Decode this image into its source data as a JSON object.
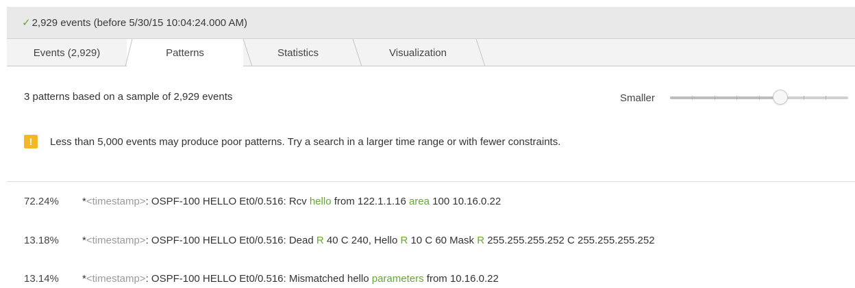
{
  "status": {
    "check_icon": "check-icon",
    "text": "2,929 events (before 5/30/15 10:04:24.000 AM)"
  },
  "tabs": [
    {
      "label": "Events (2,929)",
      "active": false
    },
    {
      "label": "Patterns",
      "active": true
    },
    {
      "label": "Statistics",
      "active": false
    },
    {
      "label": "Visualization",
      "active": false
    }
  ],
  "summary": "3 patterns based on a sample of 2,929 events",
  "slider": {
    "label": "Smaller",
    "value_fraction": 0.62
  },
  "warning": {
    "icon_glyph": "!",
    "text": "Less than 5,000 events may produce poor patterns. Try a search in a larger time range or with fewer constraints."
  },
  "patterns": [
    {
      "pct": "72.24%",
      "segments": [
        {
          "text": "*",
          "style": "plain"
        },
        {
          "text": "<timestamp>",
          "style": "ts"
        },
        {
          "text": ": OSPF-100 HELLO Et0/0.516: Rcv ",
          "style": "plain"
        },
        {
          "text": "hello",
          "style": "hl"
        },
        {
          "text": " from 122.1.1.16 ",
          "style": "plain"
        },
        {
          "text": "area",
          "style": "hl"
        },
        {
          "text": " 100 10.16.0.22",
          "style": "plain"
        }
      ]
    },
    {
      "pct": "13.18%",
      "segments": [
        {
          "text": "*",
          "style": "plain"
        },
        {
          "text": "<timestamp>",
          "style": "ts"
        },
        {
          "text": ": OSPF-100 HELLO Et0/0.516: Dead ",
          "style": "plain"
        },
        {
          "text": "R",
          "style": "hl"
        },
        {
          "text": " 40 C 240, Hello ",
          "style": "plain"
        },
        {
          "text": "R",
          "style": "hl"
        },
        {
          "text": " 10 C 60 Mask ",
          "style": "plain"
        },
        {
          "text": "R",
          "style": "hl"
        },
        {
          "text": " 255.255.255.252 C 255.255.255.252",
          "style": "plain"
        }
      ]
    },
    {
      "pct": "13.14%",
      "segments": [
        {
          "text": "*",
          "style": "plain"
        },
        {
          "text": "<timestamp>",
          "style": "ts"
        },
        {
          "text": ": OSPF-100 HELLO Et0/0.516: Mismatched hello ",
          "style": "plain"
        },
        {
          "text": "parameters",
          "style": "hl"
        },
        {
          "text": " from 10.16.0.22",
          "style": "plain"
        }
      ]
    }
  ]
}
